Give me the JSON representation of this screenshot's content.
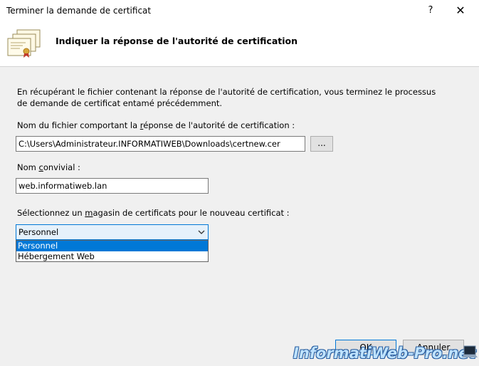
{
  "window": {
    "title": "Terminer la demande de certificat",
    "help_glyph": "?",
    "close_glyph": "✕"
  },
  "header": {
    "title": "Indiquer la réponse de l'autorité de certification",
    "icon": "certificate-stack-icon"
  },
  "body": {
    "description": "En récupérant le fichier contenant la réponse de l'autorité de certification, vous terminez le processus de demande de certificat entamé précédemment.",
    "file_label_pre": "Nom du fichier comportant la ",
    "file_label_mnemonic": "r",
    "file_label_post": "éponse de l'autorité de certification :",
    "file_value": "C:\\Users\\Administrateur.INFORMATIWEB\\Downloads\\certnew.cer",
    "browse_label": "...",
    "friendly_label_pre": "Nom ",
    "friendly_label_mnemonic": "c",
    "friendly_label_post": "onvivial :",
    "friendly_value": "web.informatiweb.lan",
    "store_label_pre": "Sélectionnez un ",
    "store_label_mnemonic": "m",
    "store_label_post": "agasin de certificats pour le nouveau certificat :",
    "store_selected": "Personnel",
    "store_options": [
      "Personnel",
      "Hébergement Web"
    ]
  },
  "buttons": {
    "ok": "OK",
    "cancel": "Annuler"
  },
  "watermark": "InformatiWeb-Pro.net",
  "colors": {
    "accent": "#0078d7",
    "window_bg": "#f0f0f0"
  }
}
